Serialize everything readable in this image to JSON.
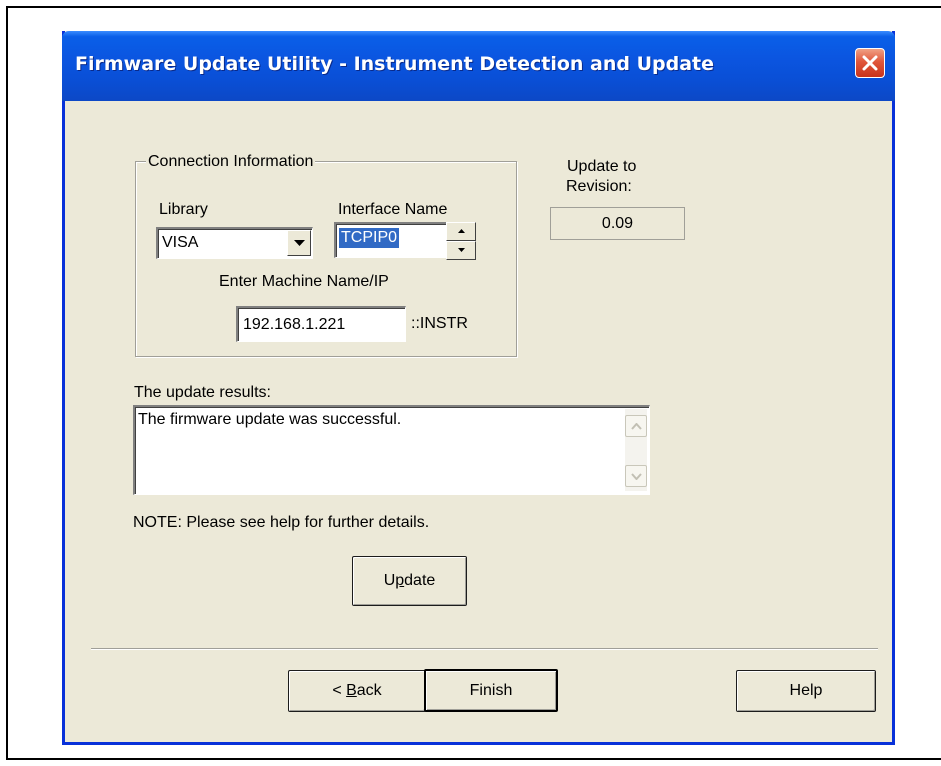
{
  "window": {
    "title": "Firmware Update Utility - Instrument Detection and Update"
  },
  "connection": {
    "group_label": "Connection Information",
    "library_label": "Library",
    "library_value": "VISA",
    "interface_label": "Interface Name",
    "interface_value": "TCPIP0",
    "machine_label": "Enter Machine Name/IP",
    "machine_value": "192.168.1.221",
    "machine_suffix": "::INSTR"
  },
  "revision": {
    "label_line1": "Update to",
    "label_line2": "Revision:",
    "value": "0.09"
  },
  "results": {
    "label": "The update results:",
    "text": "The firmware update was successful."
  },
  "note": "NOTE: Please see help for further details.",
  "buttons": {
    "update_pre": "U",
    "update_mn": "p",
    "update_post": "date",
    "back_pre": "< ",
    "back_mn": "B",
    "back_post": "ack",
    "finish": "Finish",
    "help": "Help"
  },
  "colors": {
    "titlebar": "#0a55e0",
    "dialog_bg": "#ece9d8",
    "close_button": "#e0573c",
    "selection": "#316ac5"
  },
  "icons": {
    "close": "close-x-icon",
    "dropdown": "chevron-down-icon",
    "spin_up": "spin-up-icon",
    "spin_down": "spin-down-icon"
  }
}
